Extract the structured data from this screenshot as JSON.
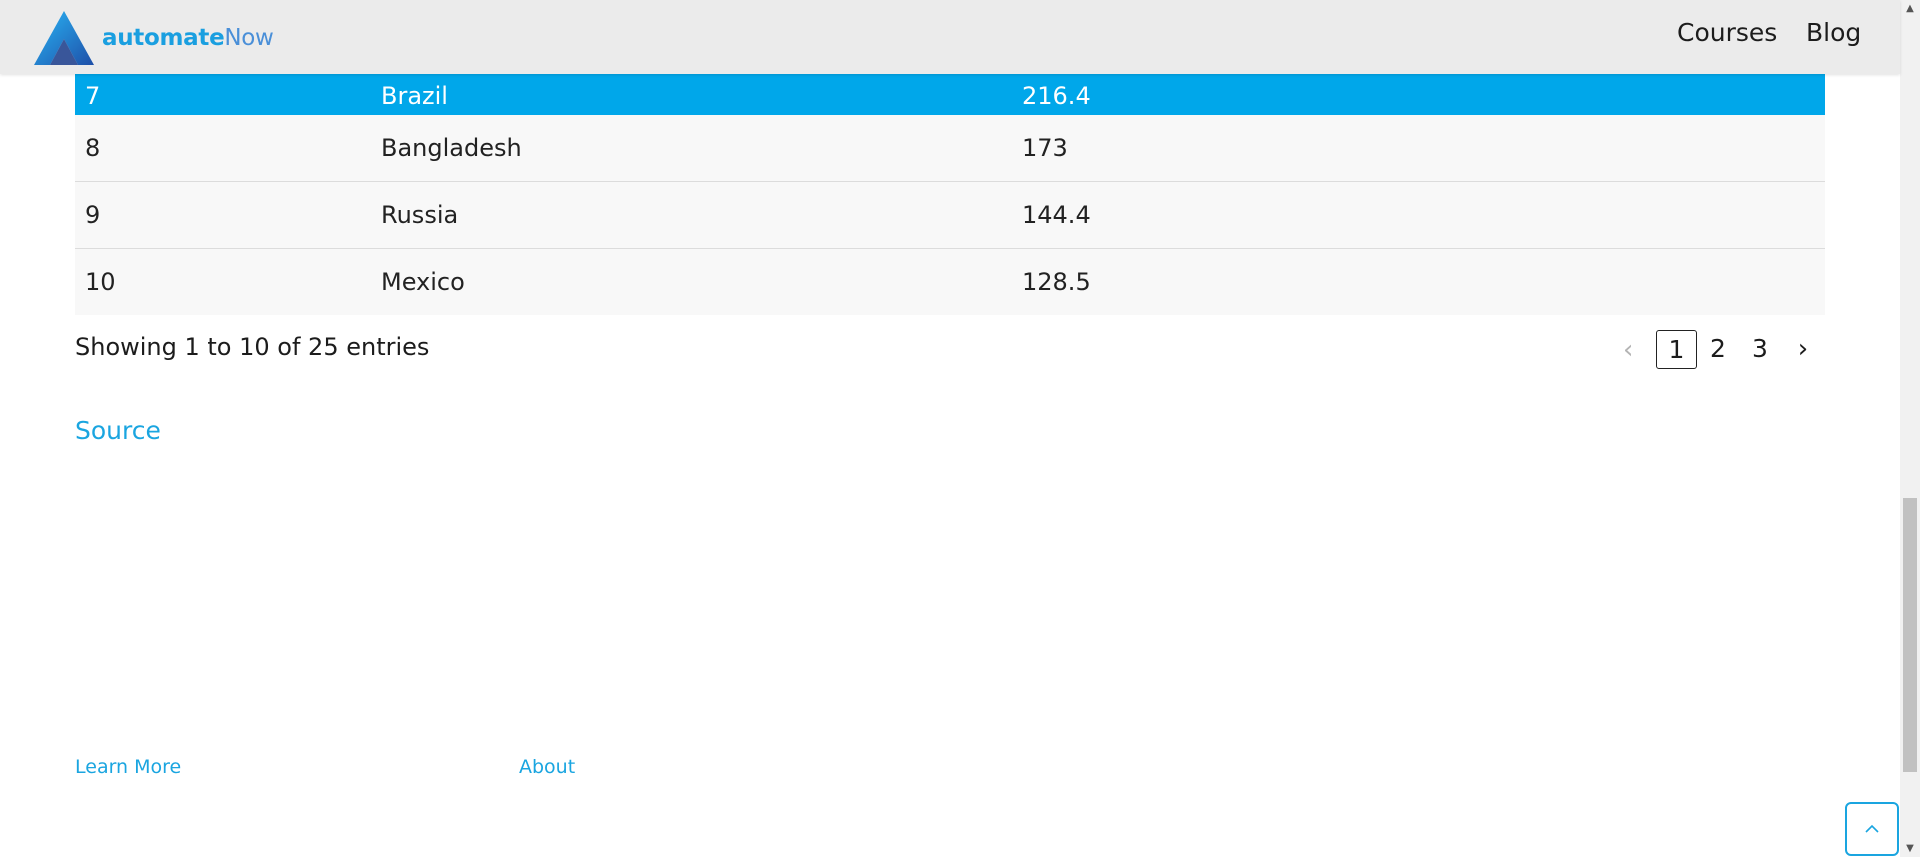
{
  "header": {
    "brand_bold": "automate",
    "brand_light": "Now",
    "nav": [
      "Courses",
      "Blog"
    ]
  },
  "table": {
    "rows": [
      {
        "rank": "7",
        "country": "Brazil",
        "value": "216.4",
        "selected": true
      },
      {
        "rank": "8",
        "country": "Bangladesh",
        "value": "173"
      },
      {
        "rank": "9",
        "country": "Russia",
        "value": "144.4"
      },
      {
        "rank": "10",
        "country": "Mexico",
        "value": "128.5"
      }
    ]
  },
  "info": "Showing 1 to 10 of 25 entries",
  "pagination": {
    "prev": "‹",
    "pages": [
      "1",
      "2",
      "3"
    ],
    "current": "1",
    "next": "›"
  },
  "source_link": "Source",
  "footer": {
    "learn_more": "Learn More",
    "about": "About"
  },
  "back_to_top_icon": "chevron-up-icon",
  "colors": {
    "accent": "#00a7ea",
    "link": "#1aa5e0",
    "header_bg": "#ebebeb"
  }
}
